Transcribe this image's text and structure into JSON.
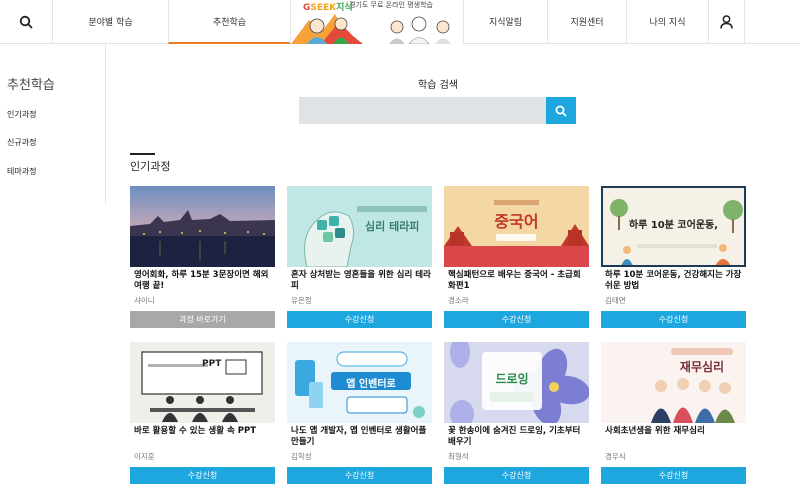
{
  "nav": {
    "items": [
      "분야별 학습",
      "추천학습",
      "지식알림",
      "지원센터",
      "나의 지식"
    ],
    "logo_parts": [
      "G",
      "SEEK",
      "지식"
    ],
    "logo_subtitle": "경기도 무료 온라인 평생학습",
    "icons": [
      "search-icon",
      "user-icon"
    ],
    "accent": "#f07b26"
  },
  "sidebar": {
    "title": "추천학습",
    "items": [
      "인기과정",
      "신규과정",
      "테마과정"
    ]
  },
  "search": {
    "title": "학습 검색",
    "placeholder": "",
    "button_color": "#1ea7df"
  },
  "section": {
    "title": "인기과정"
  },
  "courses": [
    {
      "title": "영어회화, 하루 15분 3문장이면 해외여행 끝!",
      "author": "샤이니",
      "button": "과정 바로가기",
      "thumb_text": ""
    },
    {
      "title": "혼자 상처받는 영혼들을 위한 심리 테라피",
      "author": "유은정",
      "button": "수강신청",
      "thumb_text": "심리 테라피"
    },
    {
      "title": "핵심패턴으로 배우는 중국어 - 초급회화편1",
      "author": "경소라",
      "button": "수강신청",
      "thumb_text": "중국어"
    },
    {
      "title": "하루 10분 코어운동, 건강해지는 가장 쉬운 방법",
      "author": "김태연",
      "button": "수강신청",
      "thumb_text": "하루 10분 코어운동,"
    },
    {
      "title": "바로 활용할 수 있는 생활 속 PPT",
      "author": "이지훈",
      "button": "수강신청",
      "thumb_text": "PPT"
    },
    {
      "title": "나도 앱 개발자, 앱 인벤터로 생활어플 만들기",
      "author": "김학성",
      "button": "수강신청",
      "thumb_text": "앱 인벤터로"
    },
    {
      "title": "꽃 한송이에 숨겨진 드로잉, 기초부터 배우기",
      "author": "최형석",
      "button": "수강신청",
      "thumb_text": "드로잉"
    },
    {
      "title": "사회초년생을 위한 재무심리",
      "author": "경우식",
      "button": "수강신청",
      "thumb_text": "재무심리"
    }
  ]
}
